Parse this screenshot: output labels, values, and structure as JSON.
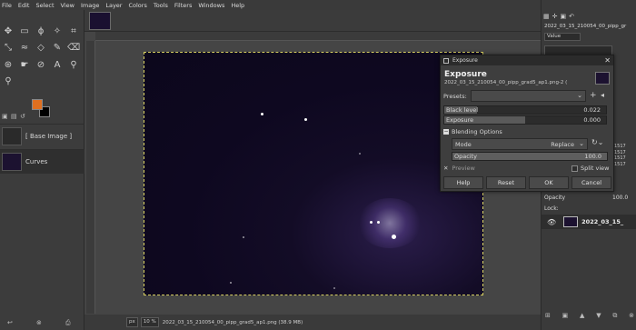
{
  "menubar": [
    "File",
    "Edit",
    "Select",
    "View",
    "Image",
    "Layer",
    "Colors",
    "Tools",
    "Filters",
    "Windows",
    "Help"
  ],
  "colors": {
    "fg": "#e07020",
    "bg": "#000000"
  },
  "layers_left": [
    {
      "label": "[ Base Image ]"
    },
    {
      "label": "Curves"
    }
  ],
  "status": {
    "unit": "px",
    "zoom": "10 %",
    "filename": "2022_03_15_210054_00_pipp_grad5_ap1.png (38.9 MB)"
  },
  "dock": {
    "image_name": "2022_03_15_210054_00_pipp_gr",
    "channel": "Value",
    "hist_vals": [
      "1517",
      "1517",
      "1517",
      "1517"
    ],
    "opacity_label": "Opacity",
    "opacity_value": "100.0",
    "lock_label": "Lock:",
    "layer_name": "2022_03_15_"
  },
  "dialog": {
    "window_title": "Exposure",
    "heading": "Exposure",
    "subtitle": "2022_03_15_210054_00_pipp_grad5_ap1.png-2 (",
    "presets_label": "Presets:",
    "black_level_label": "Black level",
    "black_level_value": "0.022",
    "black_level_fraction": 0.2,
    "exposure_label": "Exposure",
    "exposure_value": "0.000",
    "exposure_fraction": 0.5,
    "blending_label": "Blending Options",
    "mode_label": "Mode",
    "mode_value": "Replace",
    "opacity_label": "Opacity",
    "opacity_value": "100.0",
    "preview_label": "Preview",
    "split_view_label": "Split view",
    "buttons": {
      "help": "Help",
      "reset": "Reset",
      "ok": "OK",
      "cancel": "Cancel"
    }
  }
}
